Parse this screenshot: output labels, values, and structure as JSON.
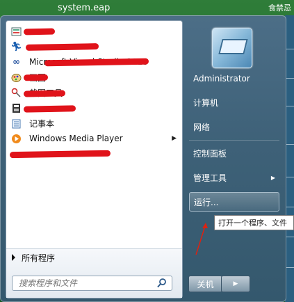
{
  "window": {
    "title": "system.eap",
    "right_text": "食禁忌"
  },
  "start_menu": {
    "pinned_items": [
      {
        "label": "",
        "icon": "app-icon-1",
        "redacted": true
      },
      {
        "label": "",
        "icon": "run-figure-icon",
        "redacted": true
      },
      {
        "label": "Microsoft Visual Studio 2010",
        "icon": "visual-studio-icon",
        "redacted": true
      },
      {
        "label": "画图",
        "icon": "paint-icon",
        "redacted": true
      },
      {
        "label": "截图工具",
        "icon": "snipping-tool-icon",
        "redacted": true
      },
      {
        "label": "",
        "icon": "app-icon-6",
        "redacted": true
      },
      {
        "label": "记事本",
        "icon": "notepad-icon",
        "redacted": false
      },
      {
        "label": "Windows Media Player",
        "icon": "media-player-icon",
        "redacted": false,
        "has_submenu": true
      },
      {
        "label": "",
        "icon": "app-icon-9",
        "redacted": true
      }
    ],
    "all_programs": "所有程序",
    "search_placeholder": "搜索程序和文件",
    "right_items": {
      "user": "Administrator",
      "computer": "计算机",
      "network": "网络",
      "control_panel": "控制面板",
      "admin_tools": "管理工具",
      "run": "运行..."
    },
    "shutdown": "关机",
    "tooltip": "打开一个程序、文件"
  }
}
